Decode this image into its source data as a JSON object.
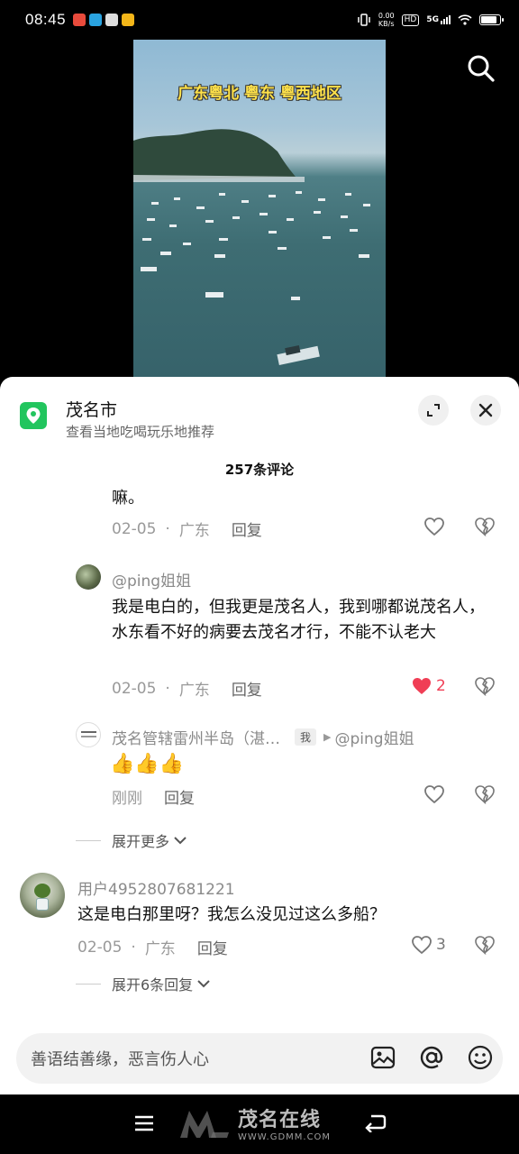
{
  "status_bar": {
    "time": "08:45",
    "net_speed_value": "0.00",
    "net_speed_unit": "KB/s",
    "hd_badge": "HD",
    "signal": "5G"
  },
  "video": {
    "caption": "广东粤北 粤东 粤西地区"
  },
  "location_card": {
    "title": "茂名市",
    "subtitle": "查看当地吃喝玩乐地推荐"
  },
  "comments_header": {
    "count_label": "257条评论"
  },
  "comments": [
    {
      "text": "嘛。",
      "date": "02-05",
      "dot": "·",
      "region": "广东",
      "reply": "回复"
    },
    {
      "username": "@ping姐姐",
      "text": "我是电白的，但我更是茂名人，我到哪都说茂名人，水东看不好的病要去茂名才行，不能不认老大",
      "date": "02-05",
      "dot": "·",
      "region": "广东",
      "reply": "回复",
      "likes": "2"
    },
    {
      "username": "茂名管辖雷州半岛（湛…",
      "me_badge": "我",
      "arrow": "▶",
      "reply_to": "@ping姐姐",
      "text": "👍👍👍",
      "date": "刚刚",
      "reply": "回复"
    },
    {
      "username": "用户4952807681221",
      "text": "这是电白那里呀？我怎么没见过这么多船？",
      "date": "02-05",
      "dot": "·",
      "region": "广东",
      "reply": "回复",
      "likes": "3"
    }
  ],
  "expand_links": {
    "more": "展开更多",
    "replies": "展开6条回复"
  },
  "input_bar": {
    "placeholder": "善语结善缘，恶言伤人心"
  },
  "watermark": {
    "text": "茂名在线",
    "url": "WWW.GDMM.COM"
  },
  "colors": {
    "like_red": "#f03e55",
    "location_green": "#22c55e",
    "caption_yellow": "#ffe24a"
  }
}
